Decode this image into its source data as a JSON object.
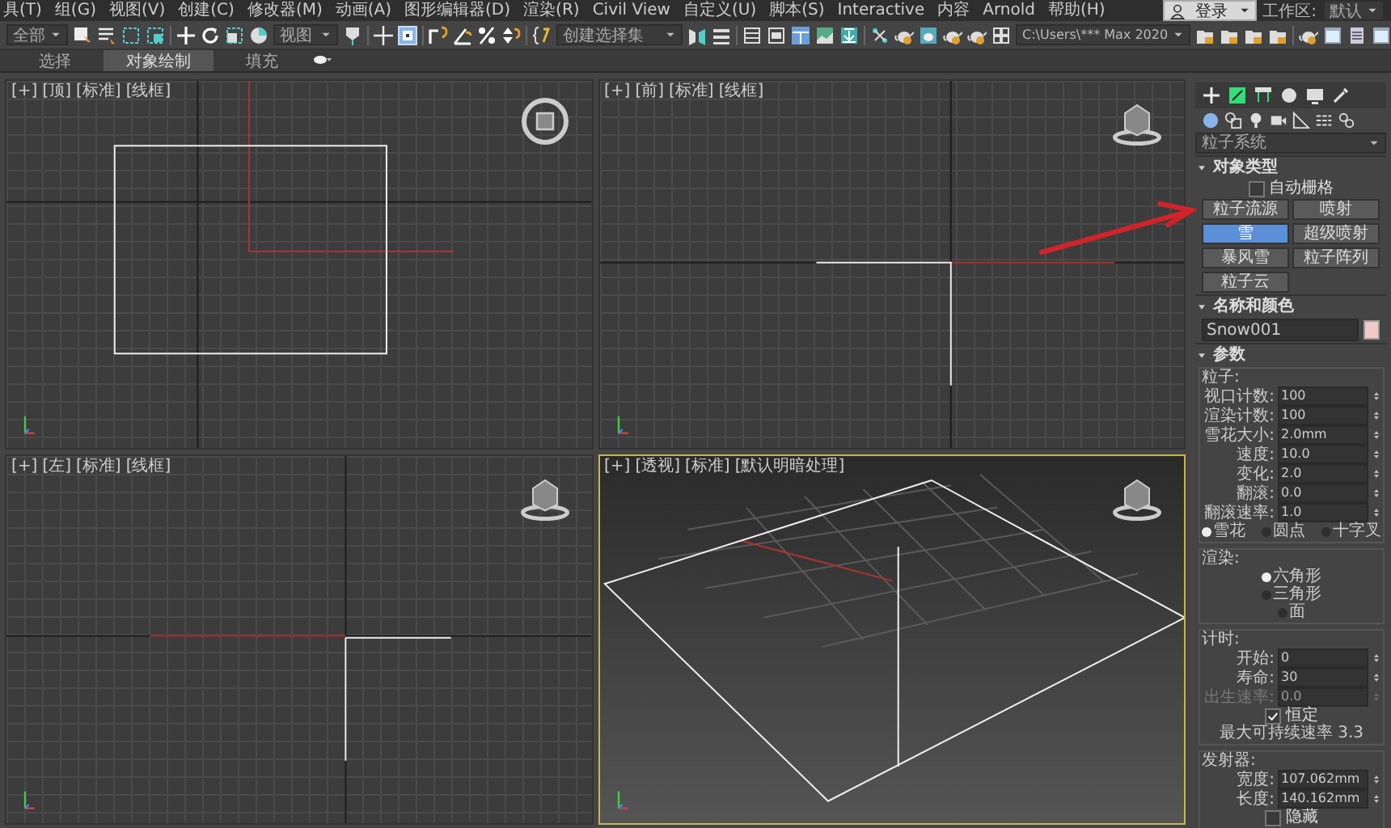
{
  "menu": [
    "具(T)",
    "组(G)",
    "视图(V)",
    "创建(C)",
    "修改器(M)",
    "动画(A)",
    "图形编辑器(D)",
    "渲染(R)",
    "Civil View",
    "自定义(U)",
    "脚本(S)",
    "Interactive",
    "内容",
    "Arnold",
    "帮助(H)"
  ],
  "account": {
    "login": "登录",
    "workspace_label": "工作区:",
    "workspace": "默认"
  },
  "toolbar": {
    "selection_filter": "全部",
    "reference_coord": "视图",
    "named_selection": "创建选择集",
    "project_path": "C:\\Users\\*** Max 2020"
  },
  "ribbon_tabs": [
    {
      "label": "选择",
      "selected": false
    },
    {
      "label": "对象绘制",
      "selected": true
    },
    {
      "label": "填充",
      "selected": false
    }
  ],
  "viewports": [
    {
      "kind": "top",
      "labels": [
        "[+]",
        "[顶]",
        "[标准]",
        "[线框]"
      ],
      "selected": false
    },
    {
      "kind": "front",
      "labels": [
        "[+]",
        "[前]",
        "[标准]",
        "[线框]"
      ],
      "selected": false
    },
    {
      "kind": "left",
      "labels": [
        "[+]",
        "[左]",
        "[标准]",
        "[线框]"
      ],
      "selected": false
    },
    {
      "kind": "perspective",
      "labels": [
        "[+]",
        "[透视]",
        "[标准]",
        "[默认明暗处理]"
      ],
      "selected": true
    }
  ],
  "command_panel": {
    "category": "粒子系统",
    "rollouts": [
      {
        "kind": "object_type",
        "title": "对象类型",
        "expanded": true,
        "auto_grid": {
          "label": "自动栅格",
          "checked": false
        },
        "buttons": [
          {
            "label": "粒子流源",
            "selected": false
          },
          {
            "label": "喷射",
            "selected": false
          },
          {
            "label": "雪",
            "selected": true
          },
          {
            "label": "超级喷射",
            "selected": false
          },
          {
            "label": "暴风雪",
            "selected": false
          },
          {
            "label": "粒子阵列",
            "selected": false
          },
          {
            "label": "粒子云",
            "selected": false
          }
        ]
      },
      {
        "kind": "name_color",
        "title": "名称和颜色",
        "expanded": true,
        "name": "Snow001",
        "color": "#f2c9c9"
      },
      {
        "kind": "params",
        "title": "参数",
        "expanded": true,
        "groups": [
          {
            "title": "粒子:",
            "items": [
              {
                "kind": "spinner",
                "label": "视口计数:",
                "value": "100",
                "disabled": false
              },
              {
                "kind": "spinner",
                "label": "渲染计数:",
                "value": "100",
                "disabled": false
              },
              {
                "kind": "spinner",
                "label": "雪花大小:",
                "value": "2.0mm",
                "disabled": false
              },
              {
                "kind": "spinner",
                "label": "速度:",
                "value": "10.0",
                "disabled": false
              },
              {
                "kind": "spinner",
                "label": "变化:",
                "value": "2.0",
                "disabled": false
              },
              {
                "kind": "spinner",
                "label": "翻滚:",
                "value": "0.0",
                "disabled": false
              },
              {
                "kind": "spinner",
                "label": "翻滚速率:",
                "value": "1.0",
                "disabled": false
              },
              {
                "kind": "radio_row",
                "options": [
                  {
                    "label": "雪花",
                    "selected": true
                  },
                  {
                    "label": "圆点",
                    "selected": false
                  },
                  {
                    "label": "十字叉",
                    "selected": false
                  }
                ]
              }
            ]
          },
          {
            "title": "渲染:",
            "items": [
              {
                "kind": "radio_list",
                "options": [
                  {
                    "label": "六角形",
                    "selected": true
                  },
                  {
                    "label": "三角形",
                    "selected": false
                  },
                  {
                    "label": "面",
                    "selected": false
                  }
                ]
              }
            ]
          },
          {
            "title": "计时:",
            "items": [
              {
                "kind": "spinner",
                "label": "开始:",
                "value": "0",
                "disabled": false
              },
              {
                "kind": "spinner",
                "label": "寿命:",
                "value": "30",
                "disabled": false
              },
              {
                "kind": "spinner",
                "label": "出生速率:",
                "value": "0.0",
                "disabled": true
              },
              {
                "kind": "checkbox",
                "label": "恒定",
                "checked": true
              },
              {
                "kind": "text",
                "text": "最大可持续速率 3.3"
              }
            ]
          },
          {
            "title": "发射器:",
            "items": [
              {
                "kind": "spinner",
                "label": "宽度:",
                "value": "107.062mm",
                "disabled": false
              },
              {
                "kind": "spinner",
                "label": "长度:",
                "value": "140.162mm",
                "disabled": false
              },
              {
                "kind": "checkbox",
                "label": "隐藏",
                "checked": false
              }
            ]
          }
        ]
      }
    ]
  }
}
